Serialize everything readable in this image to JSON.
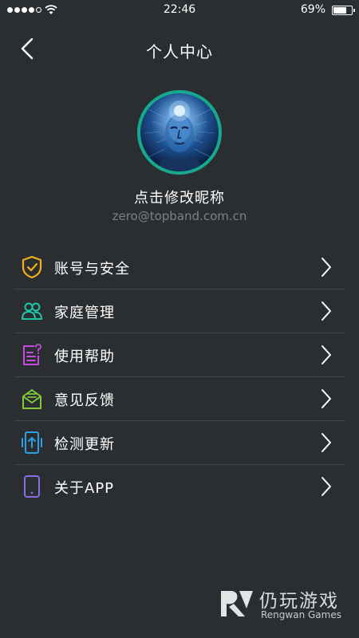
{
  "status_bar": {
    "time": "22:46",
    "battery_percent": "69%",
    "battery_level": 0.69,
    "signal_bars": 4,
    "signal_total": 5
  },
  "header": {
    "title": "个人中心",
    "back_icon": "chevron-left-icon"
  },
  "profile": {
    "nickname": "点击修改昵称",
    "email": "zero@topband.com.cn",
    "avatar_ring_color": "#17a98e"
  },
  "menu": {
    "items": [
      {
        "label": "账号与安全",
        "icon": "shield-check-icon",
        "color": "#f2b01e"
      },
      {
        "label": "家庭管理",
        "icon": "family-icon",
        "color": "#1ec7a4"
      },
      {
        "label": "使用帮助",
        "icon": "help-document-icon",
        "color": "#c84bdf"
      },
      {
        "label": "意见反馈",
        "icon": "feedback-envelope-icon",
        "color": "#7ec83a"
      },
      {
        "label": "检测更新",
        "icon": "update-check-icon",
        "color": "#2a9fe6"
      },
      {
        "label": "关于APP",
        "icon": "phone-about-icon",
        "color": "#8a6ee6"
      }
    ]
  },
  "watermark": {
    "name": "仍玩游戏",
    "subtitle": "Rengwan Games"
  }
}
